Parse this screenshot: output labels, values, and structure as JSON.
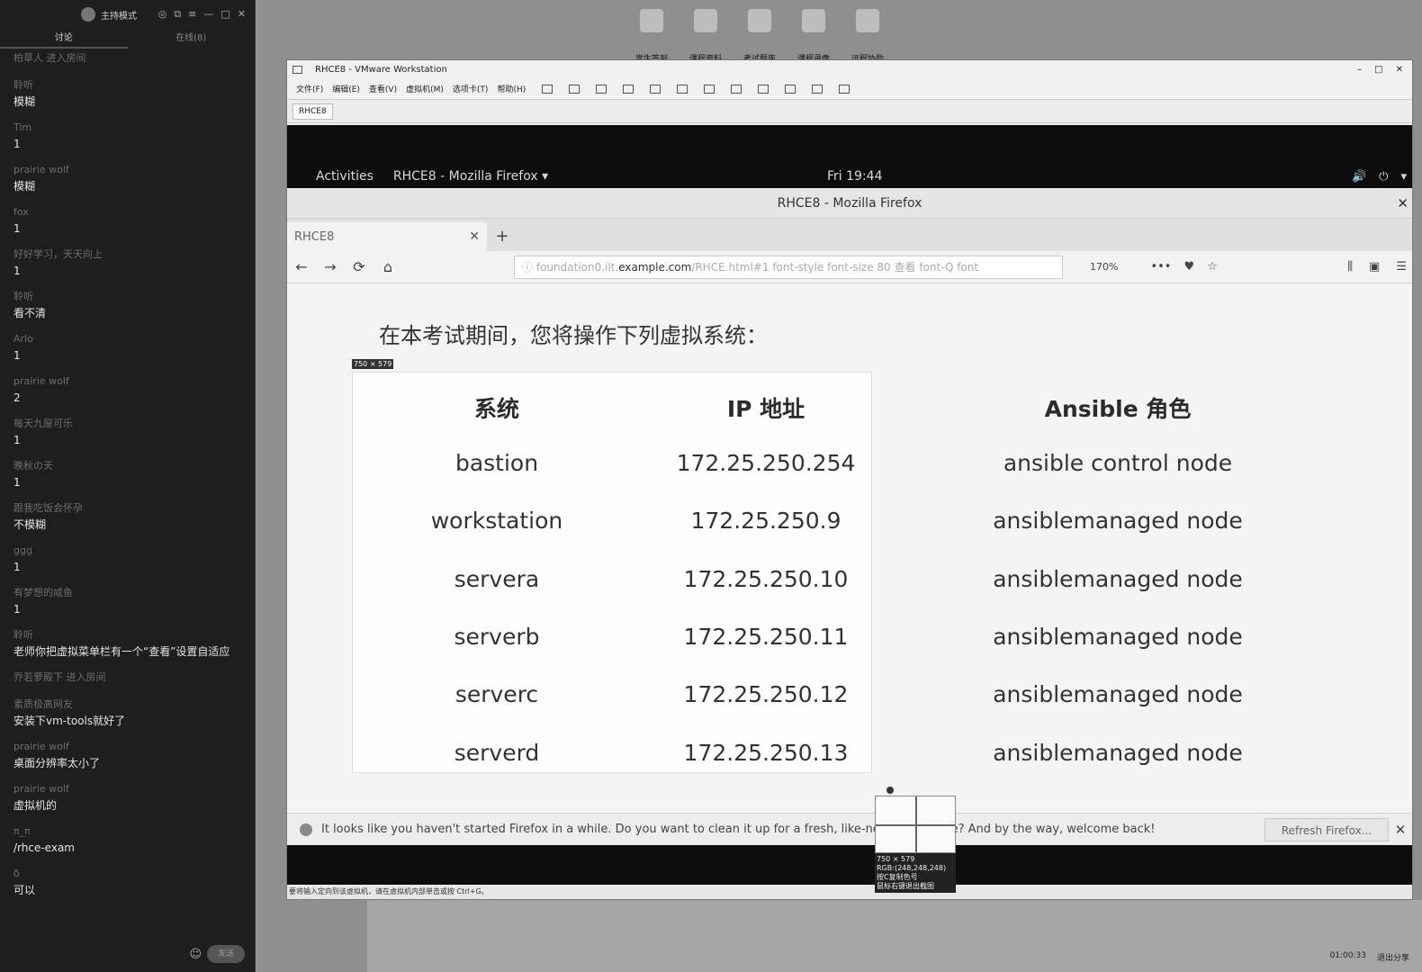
{
  "chat": {
    "title": "主持模式",
    "tabs": [
      "讨论",
      "在线(8)"
    ],
    "items": [
      {
        "type": "system",
        "text": "柏草人 进入房间"
      },
      {
        "type": "msg",
        "user": "聆听",
        "text": "模糊"
      },
      {
        "type": "msg",
        "user": "Tim",
        "text": "1"
      },
      {
        "type": "msg",
        "user": "prairie wolf",
        "text": "模糊"
      },
      {
        "type": "msg",
        "user": "fox",
        "text": "1"
      },
      {
        "type": "msg",
        "user": "好好学习，天天向上",
        "text": "1"
      },
      {
        "type": "msg",
        "user": "聆听",
        "text": "看不清"
      },
      {
        "type": "msg",
        "user": "Arlo",
        "text": "1"
      },
      {
        "type": "msg",
        "user": "prairie wolf",
        "text": "2"
      },
      {
        "type": "msg",
        "user": "每天九屋可乐",
        "text": "1"
      },
      {
        "type": "msg",
        "user": "晚秋の天",
        "text": "1"
      },
      {
        "type": "msg",
        "user": "跟我吃饭会怀孕",
        "text": "不模糊"
      },
      {
        "type": "msg",
        "user": "ggg",
        "text": "1"
      },
      {
        "type": "msg",
        "user": "有梦想的咸鱼",
        "text": "1"
      },
      {
        "type": "msg",
        "user": "聆听",
        "text": "老师你把虚拟菜单栏有一个“查看”设置自适应"
      },
      {
        "type": "system",
        "text": "乔若萝殿下 进入房间"
      },
      {
        "type": "msg",
        "user": "素质极高网友",
        "text": "安装下vm-tools就好了"
      },
      {
        "type": "msg",
        "user": "prairie wolf",
        "text": "桌面分辨率太小了"
      },
      {
        "type": "msg",
        "user": "prairie wolf",
        "text": "虚拟机的"
      },
      {
        "type": "msg",
        "user": "π_π",
        "text": "/rhce-exam"
      },
      {
        "type": "msg",
        "user": "δ",
        "text": "可以"
      }
    ],
    "send_label": "发送"
  },
  "desktop": {
    "icons": [
      "学生签到",
      "课程资料",
      "考试题库",
      "课程录像",
      "远程协助"
    ],
    "tray_time": "01:00:33",
    "tray_exit": "退出分享"
  },
  "vmware": {
    "title": "RHCE8 - VMware Workstation",
    "menu": [
      "文件(F)",
      "编辑(E)",
      "查看(V)",
      "虚拟机(M)",
      "选项卡(T)",
      "帮助(H)"
    ],
    "tab": "RHCE8",
    "status": "要将输入定向到该虚拟机，请在虚拟机内部单击或按 Ctrl+G。"
  },
  "gnome": {
    "activities": "Activities",
    "app": "RHCE8 - Mozilla Firefox ▾",
    "clock": "Fri 19:44"
  },
  "firefox": {
    "title": "RHCE8 - Mozilla Firefox",
    "tab": "RHCE8",
    "url_prefix": "foundation0.ilt.",
    "url_host": "example.com",
    "url_rest": "/RHCE.html#1 font-style font-size 80 查看 font-Q font",
    "zoom": "170%",
    "notification": "It looks like you haven't started Firefox in a while. Do you want to clean it up for a fresh, like-new experience? And by the way, welcome back!",
    "refresh_label": "Refresh Firefox..."
  },
  "page": {
    "heading": "在本考试期间，您将操作下列虚拟系统：",
    "selection_size": "750 × 579",
    "table": {
      "headers": [
        "系统",
        "IP 地址",
        "Ansible 角色"
      ],
      "rows": [
        [
          "bastion",
          "172.25.250.254",
          "ansible control node"
        ],
        [
          "workstation",
          "172.25.250.9",
          "ansiblemanaged node"
        ],
        [
          "servera",
          "172.25.250.10",
          "ansiblemanaged node"
        ],
        [
          "serverb",
          "172.25.250.11",
          "ansiblemanaged node"
        ],
        [
          "serverc",
          "172.25.250.12",
          "ansiblemanaged node"
        ],
        [
          "serverd",
          "172.25.250.13",
          "ansiblemanaged node"
        ]
      ]
    }
  },
  "magnifier": {
    "size": "750 × 579",
    "rgb": "RGB:(248,248,248)",
    "hint1": "按C复制色号",
    "hint2": "鼠标右键退出截图"
  }
}
